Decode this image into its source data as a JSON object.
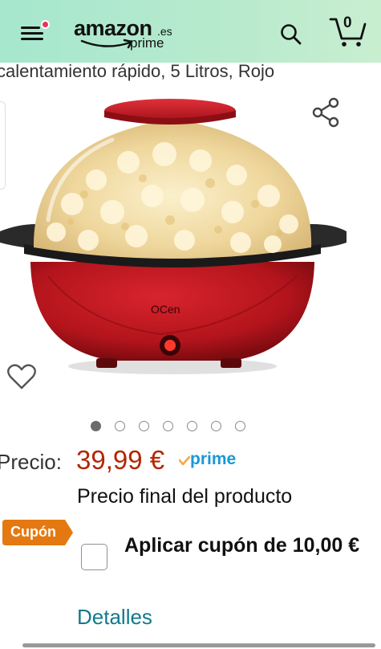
{
  "header": {
    "logo_word": "amazon",
    "logo_tld": ".es",
    "logo_sub": "prime",
    "cart_count": "0",
    "icons": {
      "menu": "hamburger-menu-icon",
      "notification": "notification-dot-icon",
      "search": "search-icon",
      "cart": "cart-icon"
    },
    "colors": {
      "gradient_start": "#a6e7ce",
      "gradient_end": "#c9eed0",
      "notification_dot": "#e8315b"
    }
  },
  "product": {
    "title_fragment": "calentamiento rápido, 5 Litros, Rojo",
    "image_description_icon": "popcorn-maker-image",
    "brand_on_product": "OCen",
    "gallery": {
      "total_images": 7,
      "active_index": 0
    },
    "icons": {
      "share": "share-icon",
      "wishlist": "heart-outline-icon"
    }
  },
  "pricing": {
    "label": "Precio:",
    "value": "39,99 €",
    "prime_label": "prime",
    "final_note": "Precio final del producto",
    "colors": {
      "price": "#b12704",
      "prime": "#1a98d5"
    }
  },
  "coupon": {
    "badge": "Cupón",
    "text": "Aplicar cupón de 10,00 €",
    "checked": false,
    "colors": {
      "badge": "#e47911"
    }
  },
  "details": {
    "link": "Detalles",
    "color": "#117a8b"
  }
}
